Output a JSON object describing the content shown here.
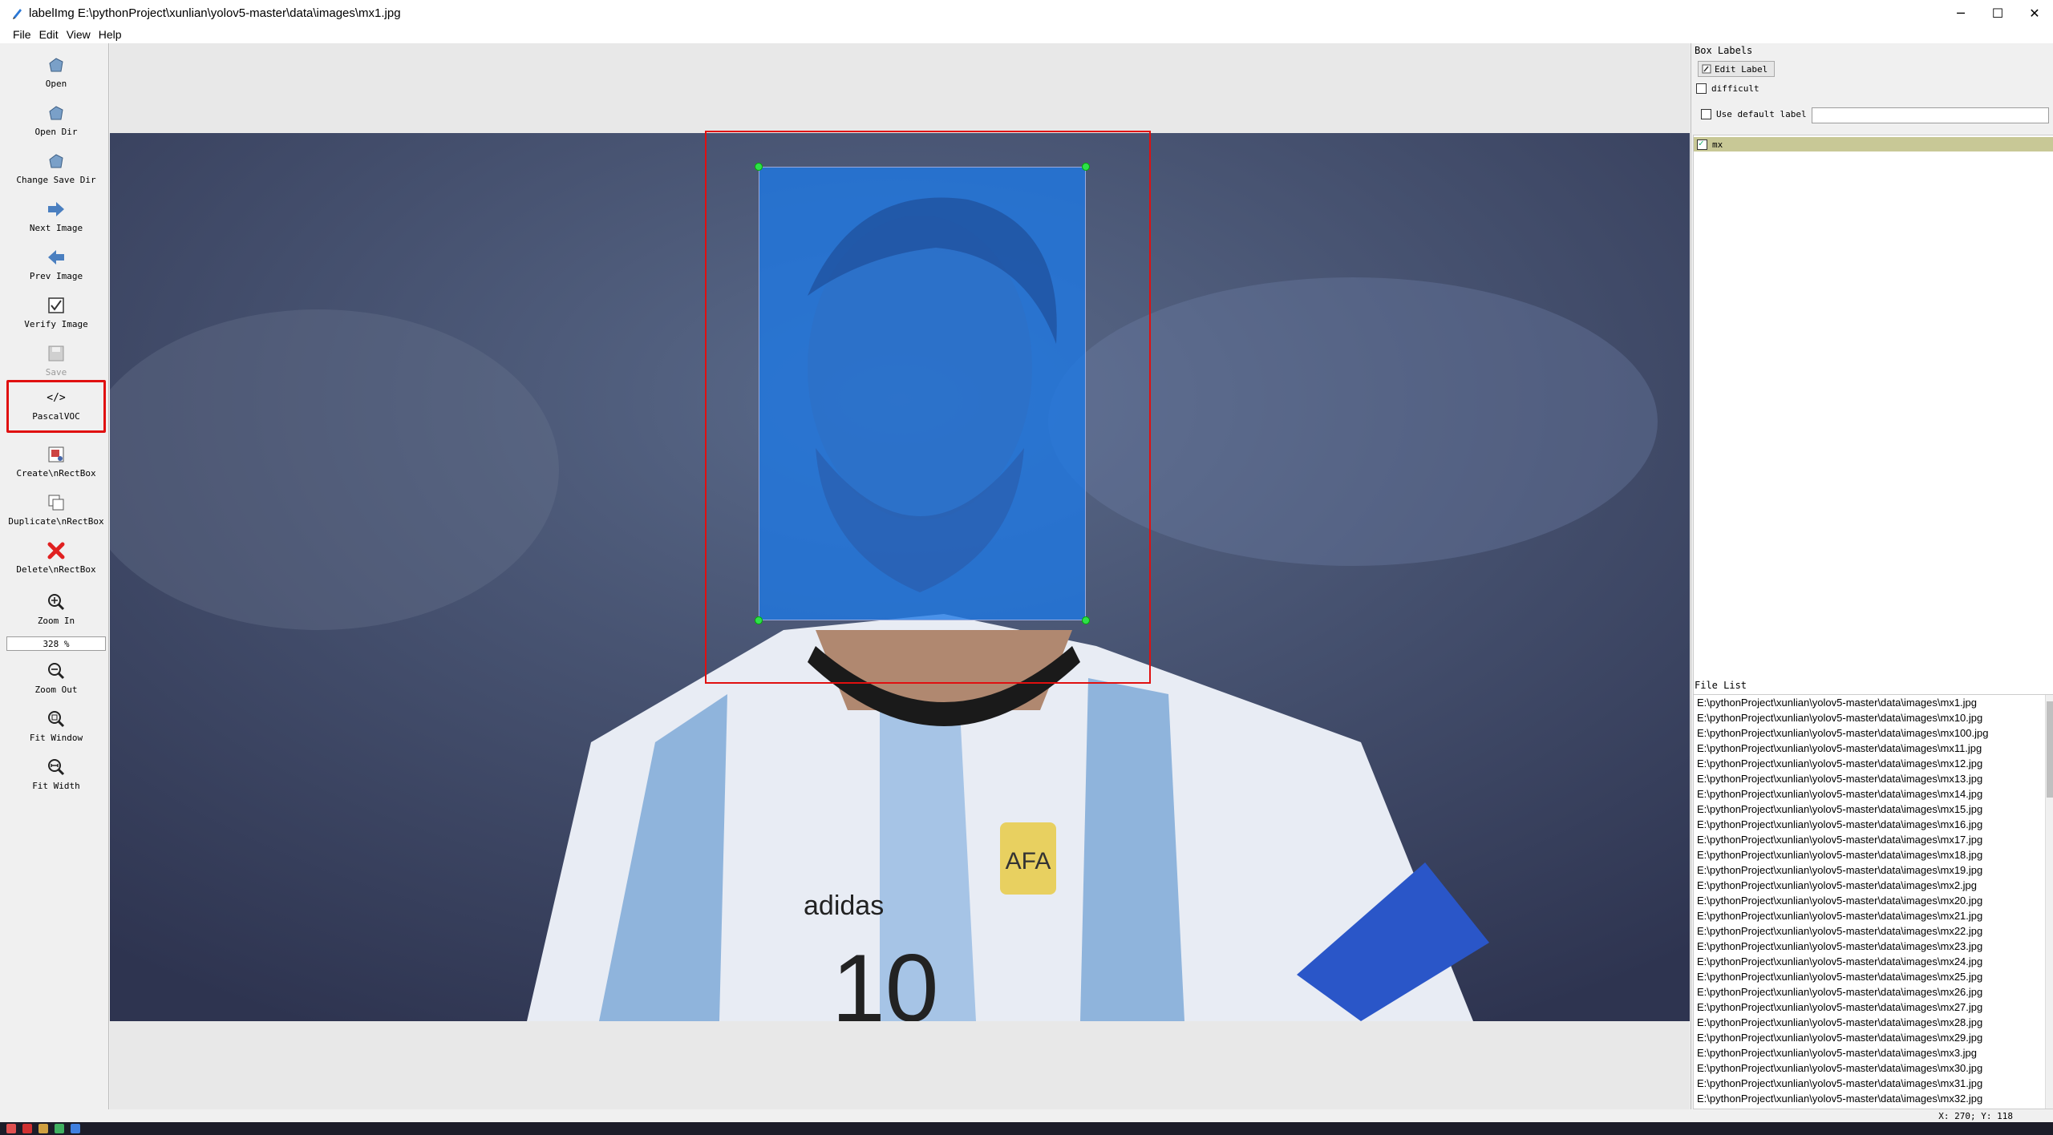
{
  "window": {
    "title": "labelImg E:\\pythonProject\\xunlian\\yolov5-master\\data\\images\\mx1.jpg",
    "minimize_glyph": "─",
    "maximize_glyph": "☐",
    "close_glyph": "✕"
  },
  "menu": [
    "File",
    "Edit",
    "View",
    "Help"
  ],
  "toolbar": {
    "open": "Open",
    "open_dir": "Open Dir",
    "change_save_dir": "Change Save Dir",
    "next_image": "Next Image",
    "prev_image": "Prev Image",
    "verify_image": "Verify Image",
    "save": "Save",
    "format": "PascalVOC",
    "format_glyph": "</>",
    "create_rect": "Create\\nRectBox",
    "duplicate_rect": "Duplicate\\nRectBox",
    "delete_rect": "Delete\\nRectBox",
    "zoom_in": "Zoom In",
    "zoom_value": "328 %",
    "zoom_out": "Zoom Out",
    "fit_window": "Fit Window",
    "fit_width": "Fit Width"
  },
  "box_labels": {
    "title": "Box Labels",
    "edit_label": "Edit Label",
    "difficult": "difficult",
    "use_default": "Use default label",
    "default_value": "",
    "labels": [
      "mx"
    ]
  },
  "file_list": {
    "title": "File List",
    "files": [
      "E:\\pythonProject\\xunlian\\yolov5-master\\data\\images\\mx1.jpg",
      "E:\\pythonProject\\xunlian\\yolov5-master\\data\\images\\mx10.jpg",
      "E:\\pythonProject\\xunlian\\yolov5-master\\data\\images\\mx100.jpg",
      "E:\\pythonProject\\xunlian\\yolov5-master\\data\\images\\mx11.jpg",
      "E:\\pythonProject\\xunlian\\yolov5-master\\data\\images\\mx12.jpg",
      "E:\\pythonProject\\xunlian\\yolov5-master\\data\\images\\mx13.jpg",
      "E:\\pythonProject\\xunlian\\yolov5-master\\data\\images\\mx14.jpg",
      "E:\\pythonProject\\xunlian\\yolov5-master\\data\\images\\mx15.jpg",
      "E:\\pythonProject\\xunlian\\yolov5-master\\data\\images\\mx16.jpg",
      "E:\\pythonProject\\xunlian\\yolov5-master\\data\\images\\mx17.jpg",
      "E:\\pythonProject\\xunlian\\yolov5-master\\data\\images\\mx18.jpg",
      "E:\\pythonProject\\xunlian\\yolov5-master\\data\\images\\mx19.jpg",
      "E:\\pythonProject\\xunlian\\yolov5-master\\data\\images\\mx2.jpg",
      "E:\\pythonProject\\xunlian\\yolov5-master\\data\\images\\mx20.jpg",
      "E:\\pythonProject\\xunlian\\yolov5-master\\data\\images\\mx21.jpg",
      "E:\\pythonProject\\xunlian\\yolov5-master\\data\\images\\mx22.jpg",
      "E:\\pythonProject\\xunlian\\yolov5-master\\data\\images\\mx23.jpg",
      "E:\\pythonProject\\xunlian\\yolov5-master\\data\\images\\mx24.jpg",
      "E:\\pythonProject\\xunlian\\yolov5-master\\data\\images\\mx25.jpg",
      "E:\\pythonProject\\xunlian\\yolov5-master\\data\\images\\mx26.jpg",
      "E:\\pythonProject\\xunlian\\yolov5-master\\data\\images\\mx27.jpg",
      "E:\\pythonProject\\xunlian\\yolov5-master\\data\\images\\mx28.jpg",
      "E:\\pythonProject\\xunlian\\yolov5-master\\data\\images\\mx29.jpg",
      "E:\\pythonProject\\xunlian\\yolov5-master\\data\\images\\mx3.jpg",
      "E:\\pythonProject\\xunlian\\yolov5-master\\data\\images\\mx30.jpg",
      "E:\\pythonProject\\xunlian\\yolov5-master\\data\\images\\mx31.jpg",
      "E:\\pythonProject\\xunlian\\yolov5-master\\data\\images\\mx32.jpg"
    ]
  },
  "status": {
    "coords": "X: 270; Y: 118"
  },
  "colors": {
    "highlight": "#e01010",
    "bbox_fill": "#1e78e6",
    "handle": "#2ee04a",
    "label_selected": "#c8c896"
  }
}
